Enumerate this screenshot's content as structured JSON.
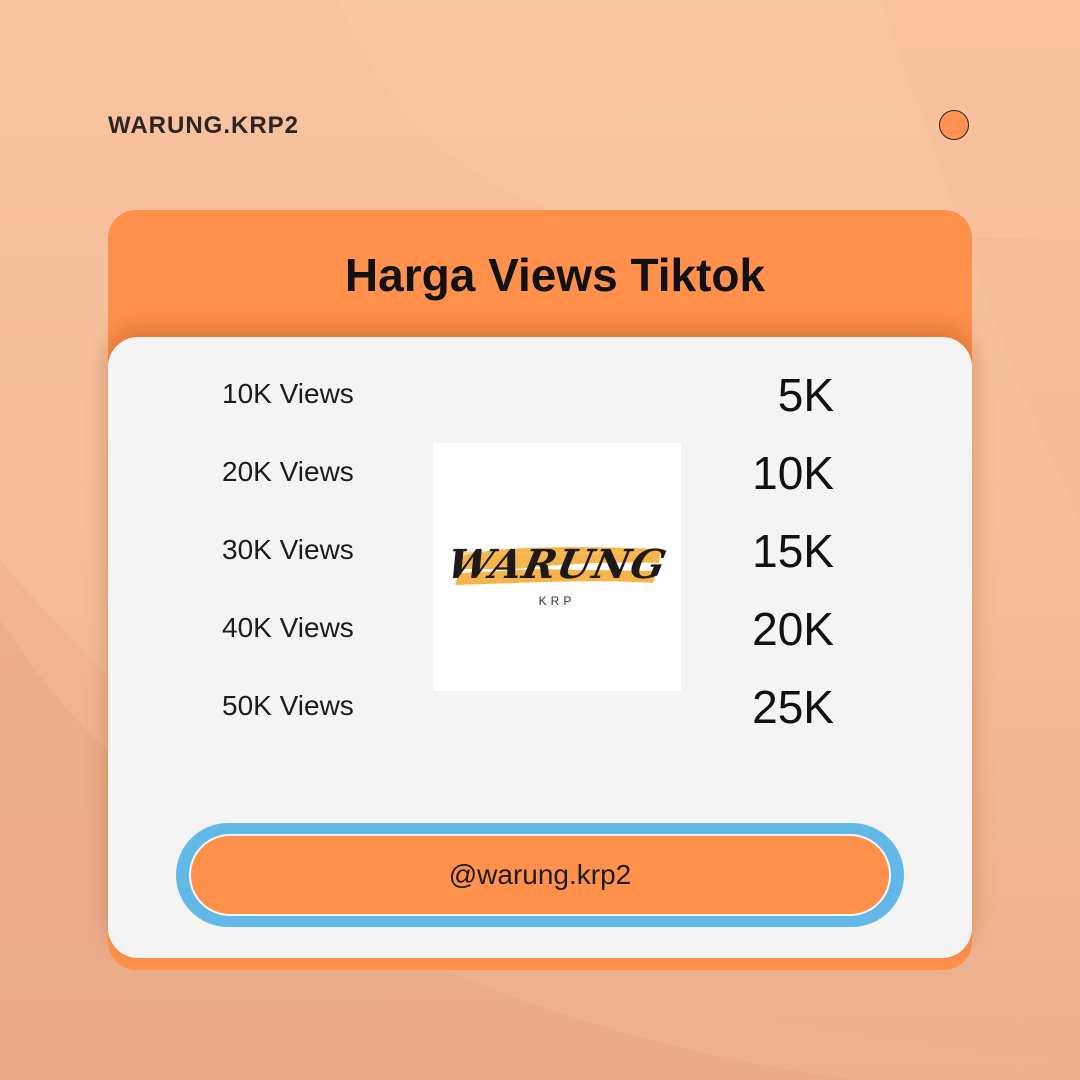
{
  "brand": "WARUNG.KRP2",
  "title": "Harga Views Tiktok",
  "rows": [
    {
      "label": "10K Views",
      "price": "5K"
    },
    {
      "label": "20K Views",
      "price": "10K"
    },
    {
      "label": "30K Views",
      "price": "15K"
    },
    {
      "label": "40K Views",
      "price": "20K"
    },
    {
      "label": "50K Views",
      "price": "25K"
    }
  ],
  "logo": {
    "word": "WARUNG",
    "sub": "KRP"
  },
  "handle": "@warung.krp2",
  "colors": {
    "background": "#f6bf9b",
    "accent": "#ff914d",
    "card": "#f4f4f4",
    "ring": "#62b9e8",
    "logo_brush": "#f6b54a"
  }
}
